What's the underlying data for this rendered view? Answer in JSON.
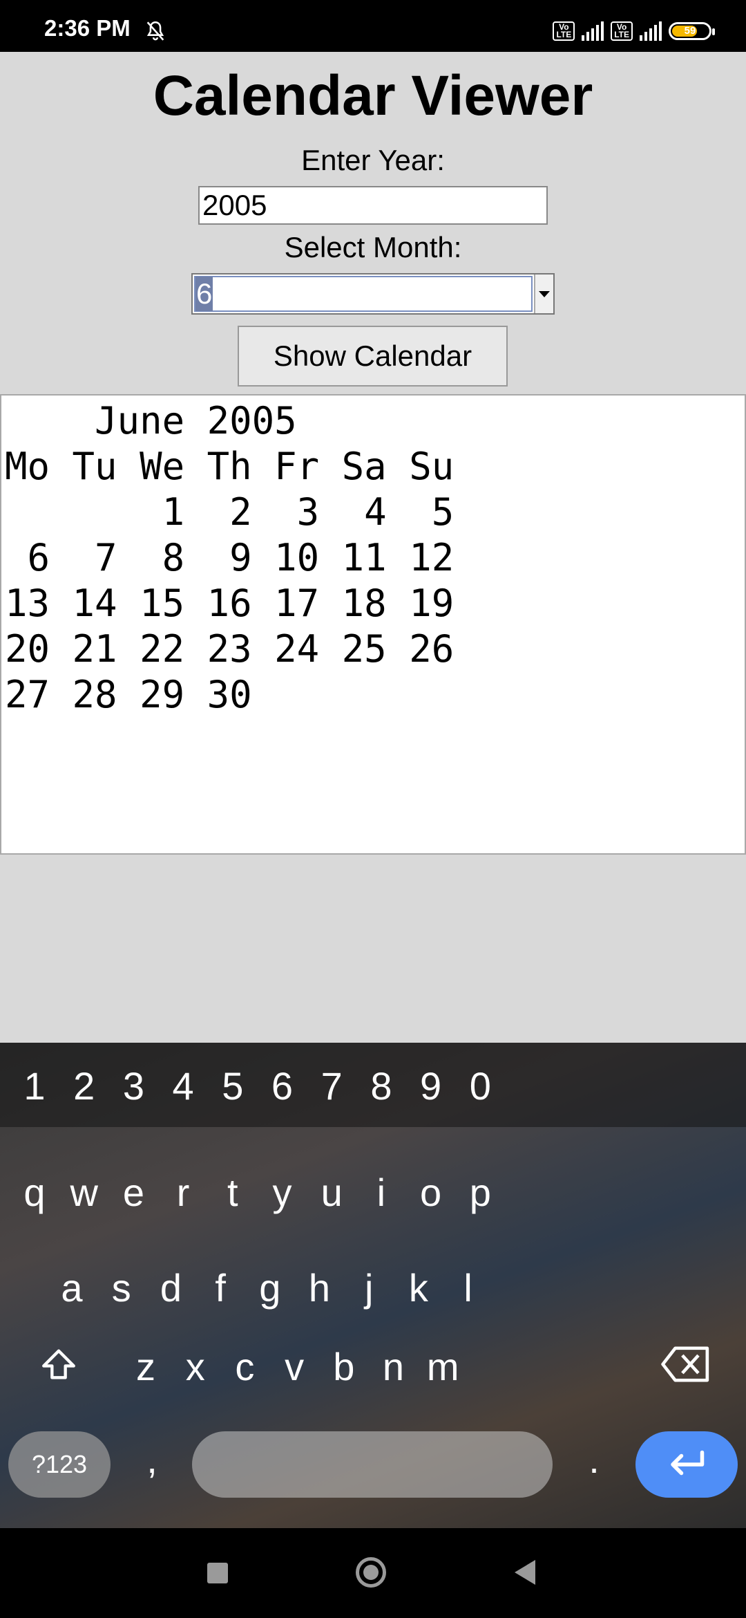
{
  "status_bar": {
    "time": "2:36 PM",
    "battery": "59"
  },
  "app": {
    "title": "Calendar Viewer",
    "year_label": "Enter Year:",
    "year_value": "2005",
    "month_label": "Select Month:",
    "month_value": "6",
    "show_button": "Show Calendar",
    "calendar_output": "    June 2005\nMo Tu We Th Fr Sa Su\n       1  2  3  4  5\n 6  7  8  9 10 11 12\n13 14 15 16 17 18 19\n20 21 22 23 24 25 26\n27 28 29 30"
  },
  "keyboard": {
    "number_row": [
      "1",
      "2",
      "3",
      "4",
      "5",
      "6",
      "7",
      "8",
      "9",
      "0"
    ],
    "row1": [
      "q",
      "w",
      "e",
      "r",
      "t",
      "y",
      "u",
      "i",
      "o",
      "p"
    ],
    "row2": [
      "a",
      "s",
      "d",
      "f",
      "g",
      "h",
      "j",
      "k",
      "l"
    ],
    "row3": [
      "z",
      "x",
      "c",
      "v",
      "b",
      "n",
      "m"
    ],
    "symbols_key": "?123",
    "comma_key": ",",
    "period_key": "."
  }
}
